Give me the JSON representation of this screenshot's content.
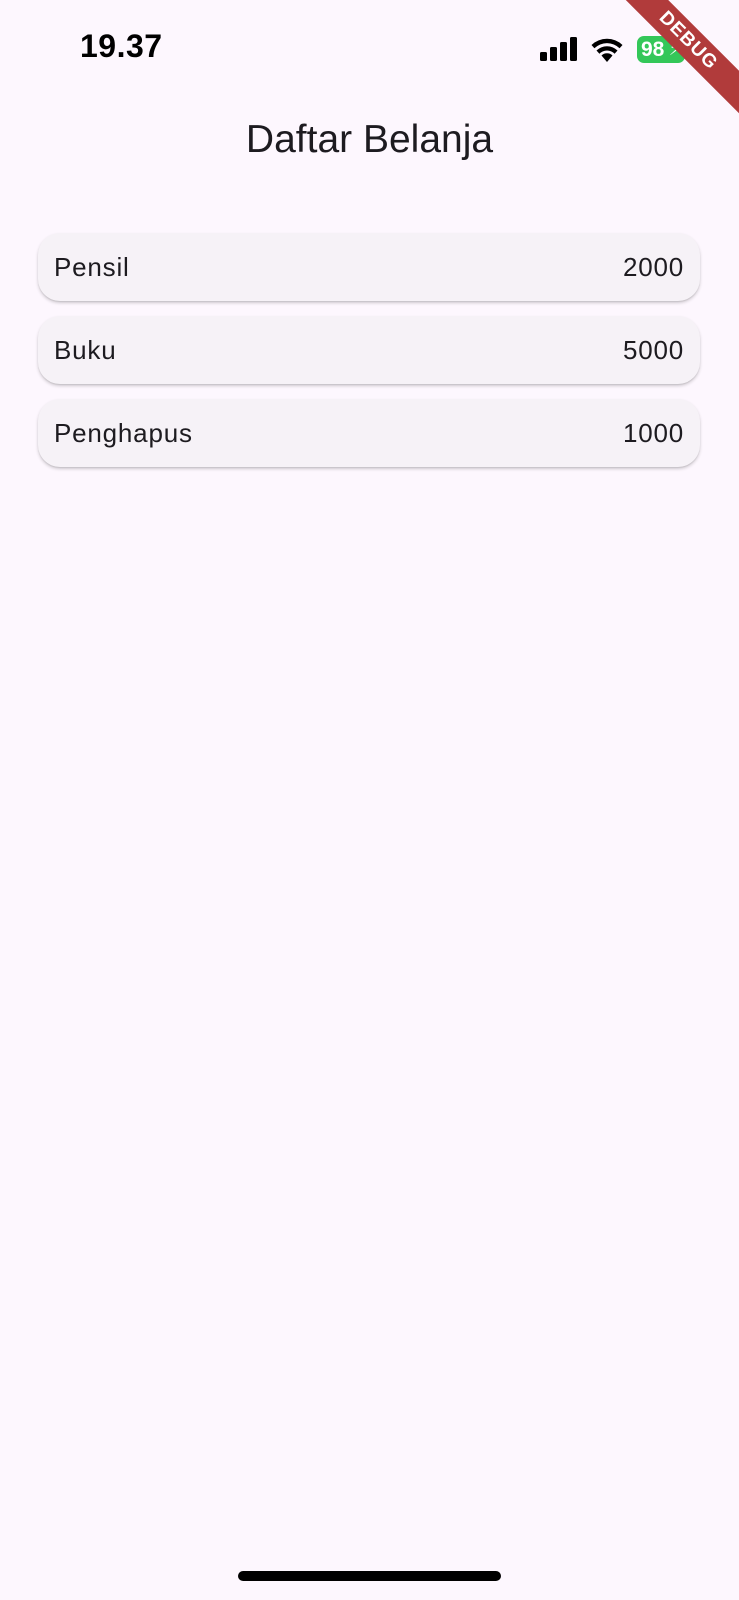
{
  "status_bar": {
    "time": "19.37",
    "battery_level": "98",
    "battery_charging": true,
    "signal_bars": 4,
    "battery_color": "#34c759"
  },
  "debug_banner": {
    "label": "DEBUG",
    "color": "#b13b3b"
  },
  "app_bar": {
    "title": "Daftar Belanja"
  },
  "items": [
    {
      "name": "Pensil",
      "price": "2000"
    },
    {
      "name": "Buku",
      "price": "5000"
    },
    {
      "name": "Penghapus",
      "price": "1000"
    }
  ],
  "theme": {
    "background": "#fdf7fe",
    "card_background": "#f6f2f7",
    "text": "#1d1b20"
  }
}
